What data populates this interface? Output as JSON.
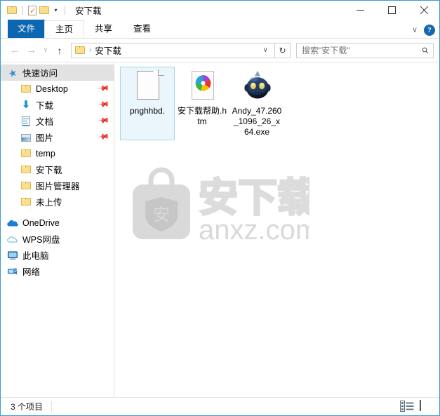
{
  "window": {
    "title": "安下载",
    "quick_access_toolbar": [
      {
        "name": "folder-icon",
        "label": "属性文件夹"
      },
      {
        "name": "properties-icon",
        "label": "属性"
      },
      {
        "name": "new-folder-icon",
        "label": "新建文件夹"
      },
      {
        "name": "customize-dropdown",
        "label": "▾"
      }
    ],
    "controls": {
      "minimize": "最小化",
      "maximize": "最大化",
      "close": "关闭"
    }
  },
  "ribbon": {
    "tabs": [
      {
        "label": "文件",
        "active": true
      },
      {
        "label": "主页",
        "active": false
      },
      {
        "label": "共享",
        "active": false
      },
      {
        "label": "查看",
        "active": false
      }
    ],
    "expand_label": "∨",
    "help_label": "?"
  },
  "address": {
    "back": "←",
    "forward": "→",
    "recent": "∨",
    "up": "↑",
    "breadcrumb_separator": "›",
    "path": "安下载",
    "dropdown": "∨",
    "refresh": "↻"
  },
  "search": {
    "placeholder": "搜索\"安下载\"",
    "value": "",
    "icon": "search-icon"
  },
  "sidebar": {
    "items": [
      {
        "label": "快速访问",
        "icon": "star-pin-icon",
        "level": 0,
        "selected": true,
        "pinned": false
      },
      {
        "label": "Desktop",
        "icon": "folder-icon",
        "level": 1,
        "selected": false,
        "pinned": true
      },
      {
        "label": "下载",
        "icon": "download-icon",
        "level": 1,
        "selected": false,
        "pinned": true
      },
      {
        "label": "文档",
        "icon": "document-icon",
        "level": 1,
        "selected": false,
        "pinned": true
      },
      {
        "label": "图片",
        "icon": "pictures-icon",
        "level": 1,
        "selected": false,
        "pinned": true
      },
      {
        "label": "temp",
        "icon": "folder-icon",
        "level": 1,
        "selected": false,
        "pinned": false
      },
      {
        "label": "安下载",
        "icon": "folder-icon",
        "level": 1,
        "selected": false,
        "pinned": false
      },
      {
        "label": "图片管理器",
        "icon": "folder-icon",
        "level": 1,
        "selected": false,
        "pinned": false
      },
      {
        "label": "未上传",
        "icon": "folder-icon",
        "level": 1,
        "selected": false,
        "pinned": false
      },
      {
        "label": "OneDrive",
        "icon": "onedrive-icon",
        "level": 0,
        "selected": false,
        "pinned": false
      },
      {
        "label": "WPS网盘",
        "icon": "wps-cloud-icon",
        "level": 0,
        "selected": false,
        "pinned": false
      },
      {
        "label": "此电脑",
        "icon": "this-pc-icon",
        "level": 0,
        "selected": false,
        "pinned": false
      },
      {
        "label": "网络",
        "icon": "network-icon",
        "level": 0,
        "selected": false,
        "pinned": false
      }
    ],
    "pin_glyph": "📌"
  },
  "files": [
    {
      "name": "pnghhbd.",
      "icon": "blank-document-icon",
      "selected": true
    },
    {
      "name": "安下载帮助.htm",
      "icon": "html-document-icon",
      "selected": false
    },
    {
      "name": "Andy_47.260_1096_26_x64.exe",
      "icon": "andy-robot-exe-icon",
      "selected": false
    }
  ],
  "watermark": {
    "brand_cn": "安下载",
    "brand_url": "anxz.com",
    "shield_char": "安",
    "color": "#d9d9d9"
  },
  "statusbar": {
    "item_count_text": "3 个项目",
    "views": [
      {
        "name": "details-view-button",
        "label": "详细信息"
      },
      {
        "name": "large-icons-view-button",
        "label": "大图标"
      }
    ]
  },
  "colors": {
    "accent": "#0c66b1",
    "window_border": "#3a9bd4",
    "selection_bg": "#eaf5fc",
    "selection_border": "#a8d5ef",
    "nav_selected_bg": "#e2e2e2",
    "folder_yellow": "#fbdf8e"
  }
}
